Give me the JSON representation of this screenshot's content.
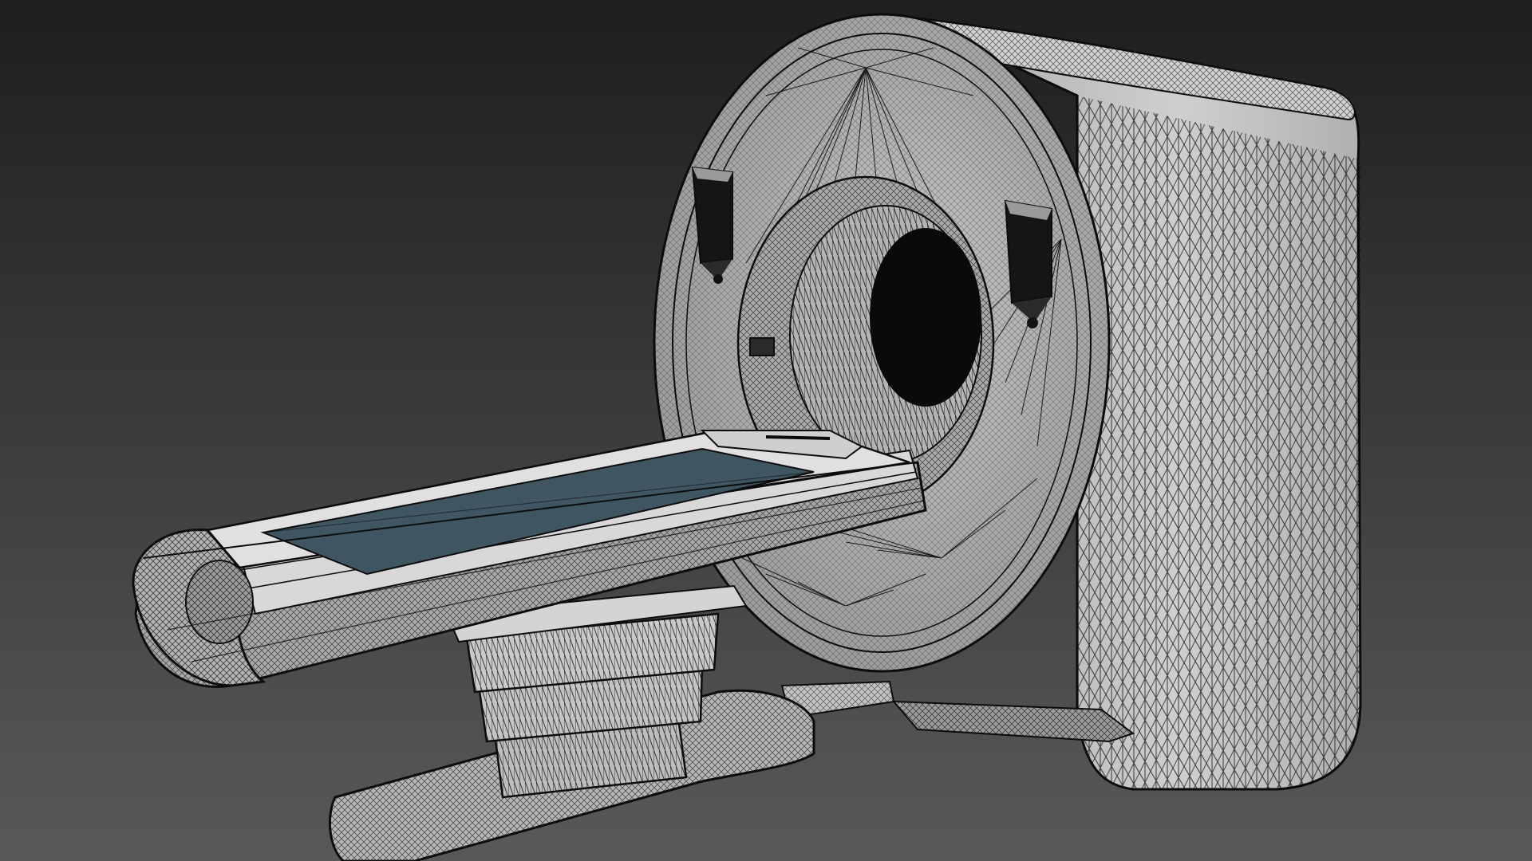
{
  "scene": {
    "subject": "ct-scanner-wireframe",
    "render_style": "wireframe-on-shaded",
    "icons": [
      "ct-scanner-icon",
      "patient-table-icon"
    ],
    "colors": {
      "background_top": "#1e1e1e",
      "background_bottom": "#595959",
      "surface": "#b9b9b9",
      "surface_light": "#d6d6d6",
      "surface_dark": "#8c8c8c",
      "wire": "#0c0c0c",
      "mattress": "#3f5561",
      "bore": "#0a0a0a"
    }
  }
}
